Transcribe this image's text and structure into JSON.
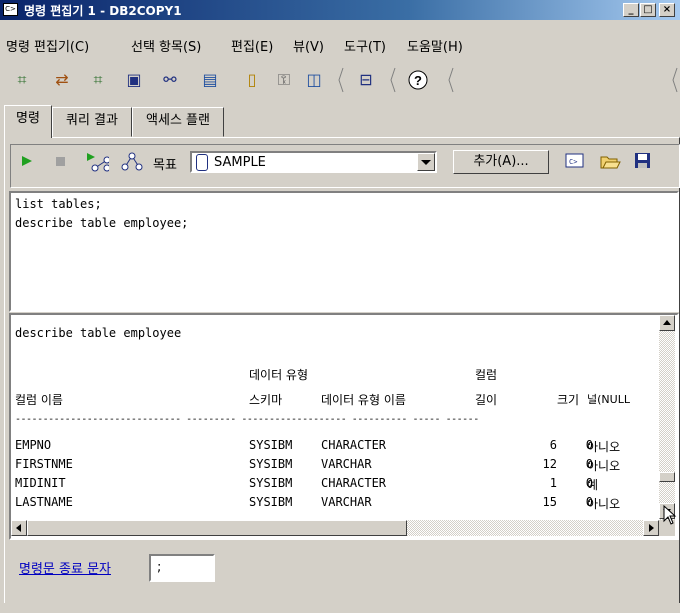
{
  "window": {
    "title": "명령 편집기 1 - DB2COPY1",
    "app_icon": "console-icon",
    "minimize": "_",
    "maximize": "□",
    "close": "×"
  },
  "menu": [
    "명령 편집기(C)",
    "선택 항목(S)",
    "편집(E)",
    "뷰(V)",
    "도구(T)",
    "도움말(H)"
  ],
  "toolbar_icons": [
    "control-center-icon",
    "replication-center-icon",
    "satellite-admin-icon",
    "command-editor-icon",
    "task-center-icon",
    "health-center-icon",
    "journal-icon",
    "license-center-icon",
    "configuration-assistant-icon",
    "tools-settings-icon",
    "help-icon"
  ],
  "tabs": [
    "명령",
    "쿼리 결과",
    "액세스 플랜"
  ],
  "command_bar": {
    "target_label": "목표",
    "target_value": "SAMPLE",
    "add_label": "추가(A)..."
  },
  "editor": {
    "lines": [
      "list tables;",
      "describe table employee;"
    ]
  },
  "output": {
    "command": "describe table employee",
    "header1": [
      "",
      "데이터 유형",
      "",
      "컬럼",
      "",
      ""
    ],
    "header2": [
      "컬럼 이름",
      "스키마",
      "데이터 유형 이름",
      "길이",
      "크기",
      "널(NULL"
    ],
    "divider": "------------------------------ --------- ------------------- ---------- ----- ------",
    "rows": [
      [
        "EMPNO",
        "SYSIBM",
        "CHARACTER",
        "6",
        "0",
        "아니오"
      ],
      [
        "FIRSTNME",
        "SYSIBM",
        "VARCHAR",
        "12",
        "0",
        "아니오"
      ],
      [
        "MIDINIT",
        "SYSIBM",
        "CHARACTER",
        "1",
        "0",
        "예"
      ],
      [
        "LASTNAME",
        "SYSIBM",
        "VARCHAR",
        "15",
        "0",
        "아니오"
      ]
    ]
  },
  "footer": {
    "terminator_label": "명령문 종료 문자",
    "terminator_value": ";"
  }
}
